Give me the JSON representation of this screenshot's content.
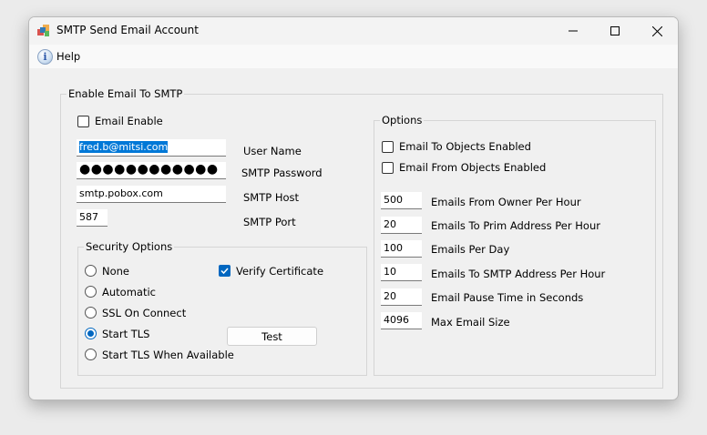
{
  "window": {
    "title": "SMTP Send Email Account"
  },
  "menu": {
    "help_label": "Help"
  },
  "smtp_group": {
    "legend": "Enable Email To SMTP",
    "email_enable_label": "Email Enable",
    "email_enable_checked": false,
    "user_name_value": "fred.b@mitsi.com",
    "user_name_label": "User Name",
    "password_value": "●●●●●●●●●●●●",
    "password_label": "SMTP Password",
    "host_value": "smtp.pobox.com",
    "host_label": "SMTP Host",
    "port_value": "587",
    "port_label": "SMTP Port"
  },
  "security": {
    "legend": "Security Options",
    "options": [
      {
        "label": "None",
        "selected": false
      },
      {
        "label": "Automatic",
        "selected": false
      },
      {
        "label": "SSL On Connect",
        "selected": false
      },
      {
        "label": "Start TLS",
        "selected": true
      },
      {
        "label": "Start TLS When Available",
        "selected": false
      }
    ],
    "verify_certificate_label": "Verify Certificate",
    "verify_certificate_checked": true,
    "test_button_label": "Test"
  },
  "options": {
    "legend": "Options",
    "email_to_objects_label": "Email To Objects Enabled",
    "email_to_objects_checked": false,
    "email_from_objects_label": "Email From Objects Enabled",
    "email_from_objects_checked": false,
    "fields": [
      {
        "value": "500",
        "label": "Emails From Owner Per Hour"
      },
      {
        "value": "20",
        "label": "Emails To Prim Address Per Hour"
      },
      {
        "value": "100",
        "label": "Emails Per Day"
      },
      {
        "value": "10",
        "label": "Emails To SMTP Address Per Hour"
      },
      {
        "value": "20",
        "label": "Email Pause Time in Seconds"
      },
      {
        "value": "4096",
        "label": "Max Email Size"
      }
    ]
  },
  "colors": {
    "accent": "#0067c0",
    "selection": "#0078d7"
  }
}
